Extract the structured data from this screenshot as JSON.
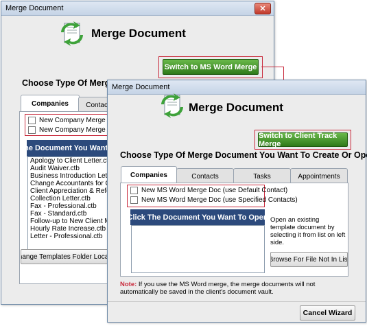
{
  "back_window": {
    "title": "Merge Document",
    "header_title": "Merge Document",
    "switch_button": "Switch to MS Word Merge",
    "section_title": "Choose Type Of Merge Document You Want To Create Or Open",
    "tabs": [
      "Companies",
      "Contacts"
    ],
    "checkboxes": [
      "New Company Merge Doc (use Default Contact)",
      "New Company Merge Doc (use Specified Contacts)"
    ],
    "list_header": "Click The Document You Want To Open",
    "list_items": [
      "Apology to Client Letter.ctb",
      "Audit Waiver.ctb",
      "Business Introduction Letter.ctb",
      "Change Accountants for Client.ctb",
      "Client Appreciation & Referral.ctb",
      "Collection Letter.ctb",
      "Fax - Professional.ctb",
      "Fax - Standard.ctb",
      "Follow-up to New Client Meeting.ctb",
      "Hourly Rate Increase.ctb",
      "Letter - Professional.ctb"
    ],
    "change_folder_button": "Change Templates Folder Location"
  },
  "front_window": {
    "title": "Merge Document",
    "header_title": "Merge Document",
    "switch_button": "Switch to Client Track Merge",
    "section_title": "Choose Type Of Merge Document You Want To Create Or Open",
    "tabs": [
      "Companies",
      "Contacts",
      "Tasks",
      "Appointments"
    ],
    "checkboxes": [
      "New MS Word Merge Doc (use Default Contact)",
      "New MS Word Merge Doc (use Specified Contacts)"
    ],
    "list_header": "Click The Document You Want To Open",
    "help_text": "Open an existing template document by selecting it from list on left side.",
    "browse_button": "Browse For File Not In List",
    "note_label": "Note:",
    "note_text": "If you use the MS Word merge, the merge documents will not automatically be saved in the client's document vault.",
    "cancel_button": "Cancel Wizard"
  },
  "colors": {
    "accent_red": "#c8283a",
    "button_green": "#3f8f22",
    "list_header_navy": "#2c4a7c"
  }
}
